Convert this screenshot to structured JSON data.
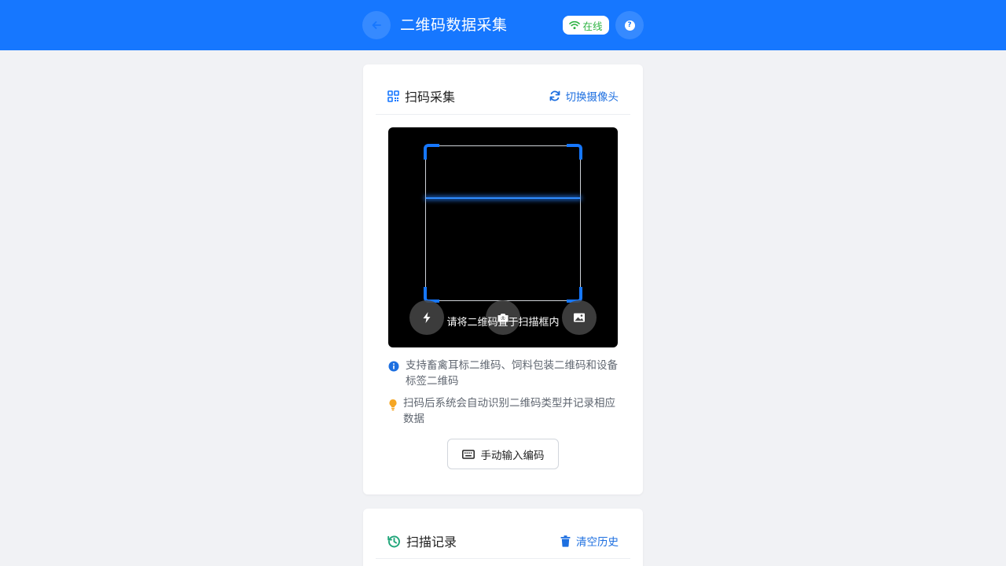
{
  "header": {
    "title": "二维码数据采集",
    "status_label": "在线",
    "back_icon": "arrow-left-icon",
    "help_icon": "help-icon",
    "status_icon": "wifi-icon"
  },
  "scan_card": {
    "title": "扫码采集",
    "switch_camera_label": "切换摄像头",
    "scanner": {
      "hint": "请将二维码置于扫描框内",
      "buttons": [
        "flash-icon",
        "camera-icon",
        "image-icon"
      ]
    },
    "tips": [
      "支持畜禽耳标二维码、饲料包装二维码和设备标签二维码",
      "扫码后系统会自动识别二维码类型并记录相应数据"
    ],
    "manual_input_label": "手动输入编码"
  },
  "history_card": {
    "title": "扫描记录",
    "clear_label": "清空历史"
  },
  "colors": {
    "primary": "#1677ff",
    "online": "#2fb344",
    "history_icon": "#21a67a",
    "tip_bulb": "#f5a623"
  }
}
